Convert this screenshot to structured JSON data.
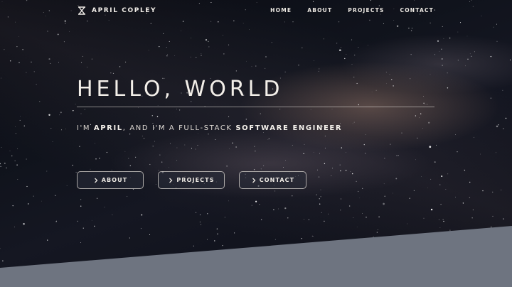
{
  "brand": {
    "name": "APRIL COPLEY",
    "logo_icon": "ac-monogram-icon"
  },
  "nav": {
    "links": [
      "HOME",
      "ABOUT",
      "PROJECTS",
      "CONTACT"
    ]
  },
  "hero": {
    "title": "HELLO, WORLD",
    "tagline": {
      "part1": "I'M ",
      "name": "APRIL",
      "part2": ", AND I'M A FULL-STACK ",
      "role": "SOFTWARE ENGINEER"
    },
    "buttons": [
      {
        "label": "ABOUT",
        "icon": "chevron-right-icon"
      },
      {
        "label": "PROJECTS",
        "icon": "chevron-right-icon"
      },
      {
        "label": "CONTACT",
        "icon": "chevron-right-icon"
      }
    ]
  },
  "colors": {
    "footer_slope": "#6e7480",
    "text": "#f3efe9",
    "background": "#0b0d14"
  }
}
